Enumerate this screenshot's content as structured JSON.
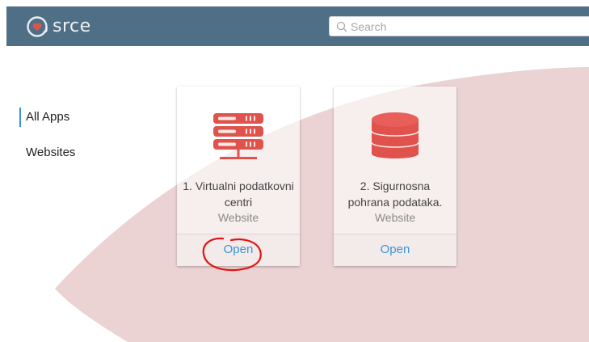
{
  "header": {
    "logo_text": "srce",
    "search_placeholder": "Search"
  },
  "sidebar": {
    "items": [
      {
        "label": "All Apps",
        "active": true
      },
      {
        "label": "Websites",
        "active": false
      }
    ]
  },
  "apps": [
    {
      "title": "1. Virtualni podatkovni centri",
      "type": "Website",
      "action_label": "Open",
      "icon": "server-rack-icon"
    },
    {
      "title": "2. Sigurnosna pohrana podataka.",
      "type": "Website",
      "action_label": "Open",
      "icon": "database-icon"
    }
  ],
  "colors": {
    "header_bg": "#4f6f86",
    "accent_red": "#e0524c",
    "link_blue": "#3a95d6",
    "swoosh_pink": "#ebd3d3",
    "annotation_red": "#e41414"
  }
}
